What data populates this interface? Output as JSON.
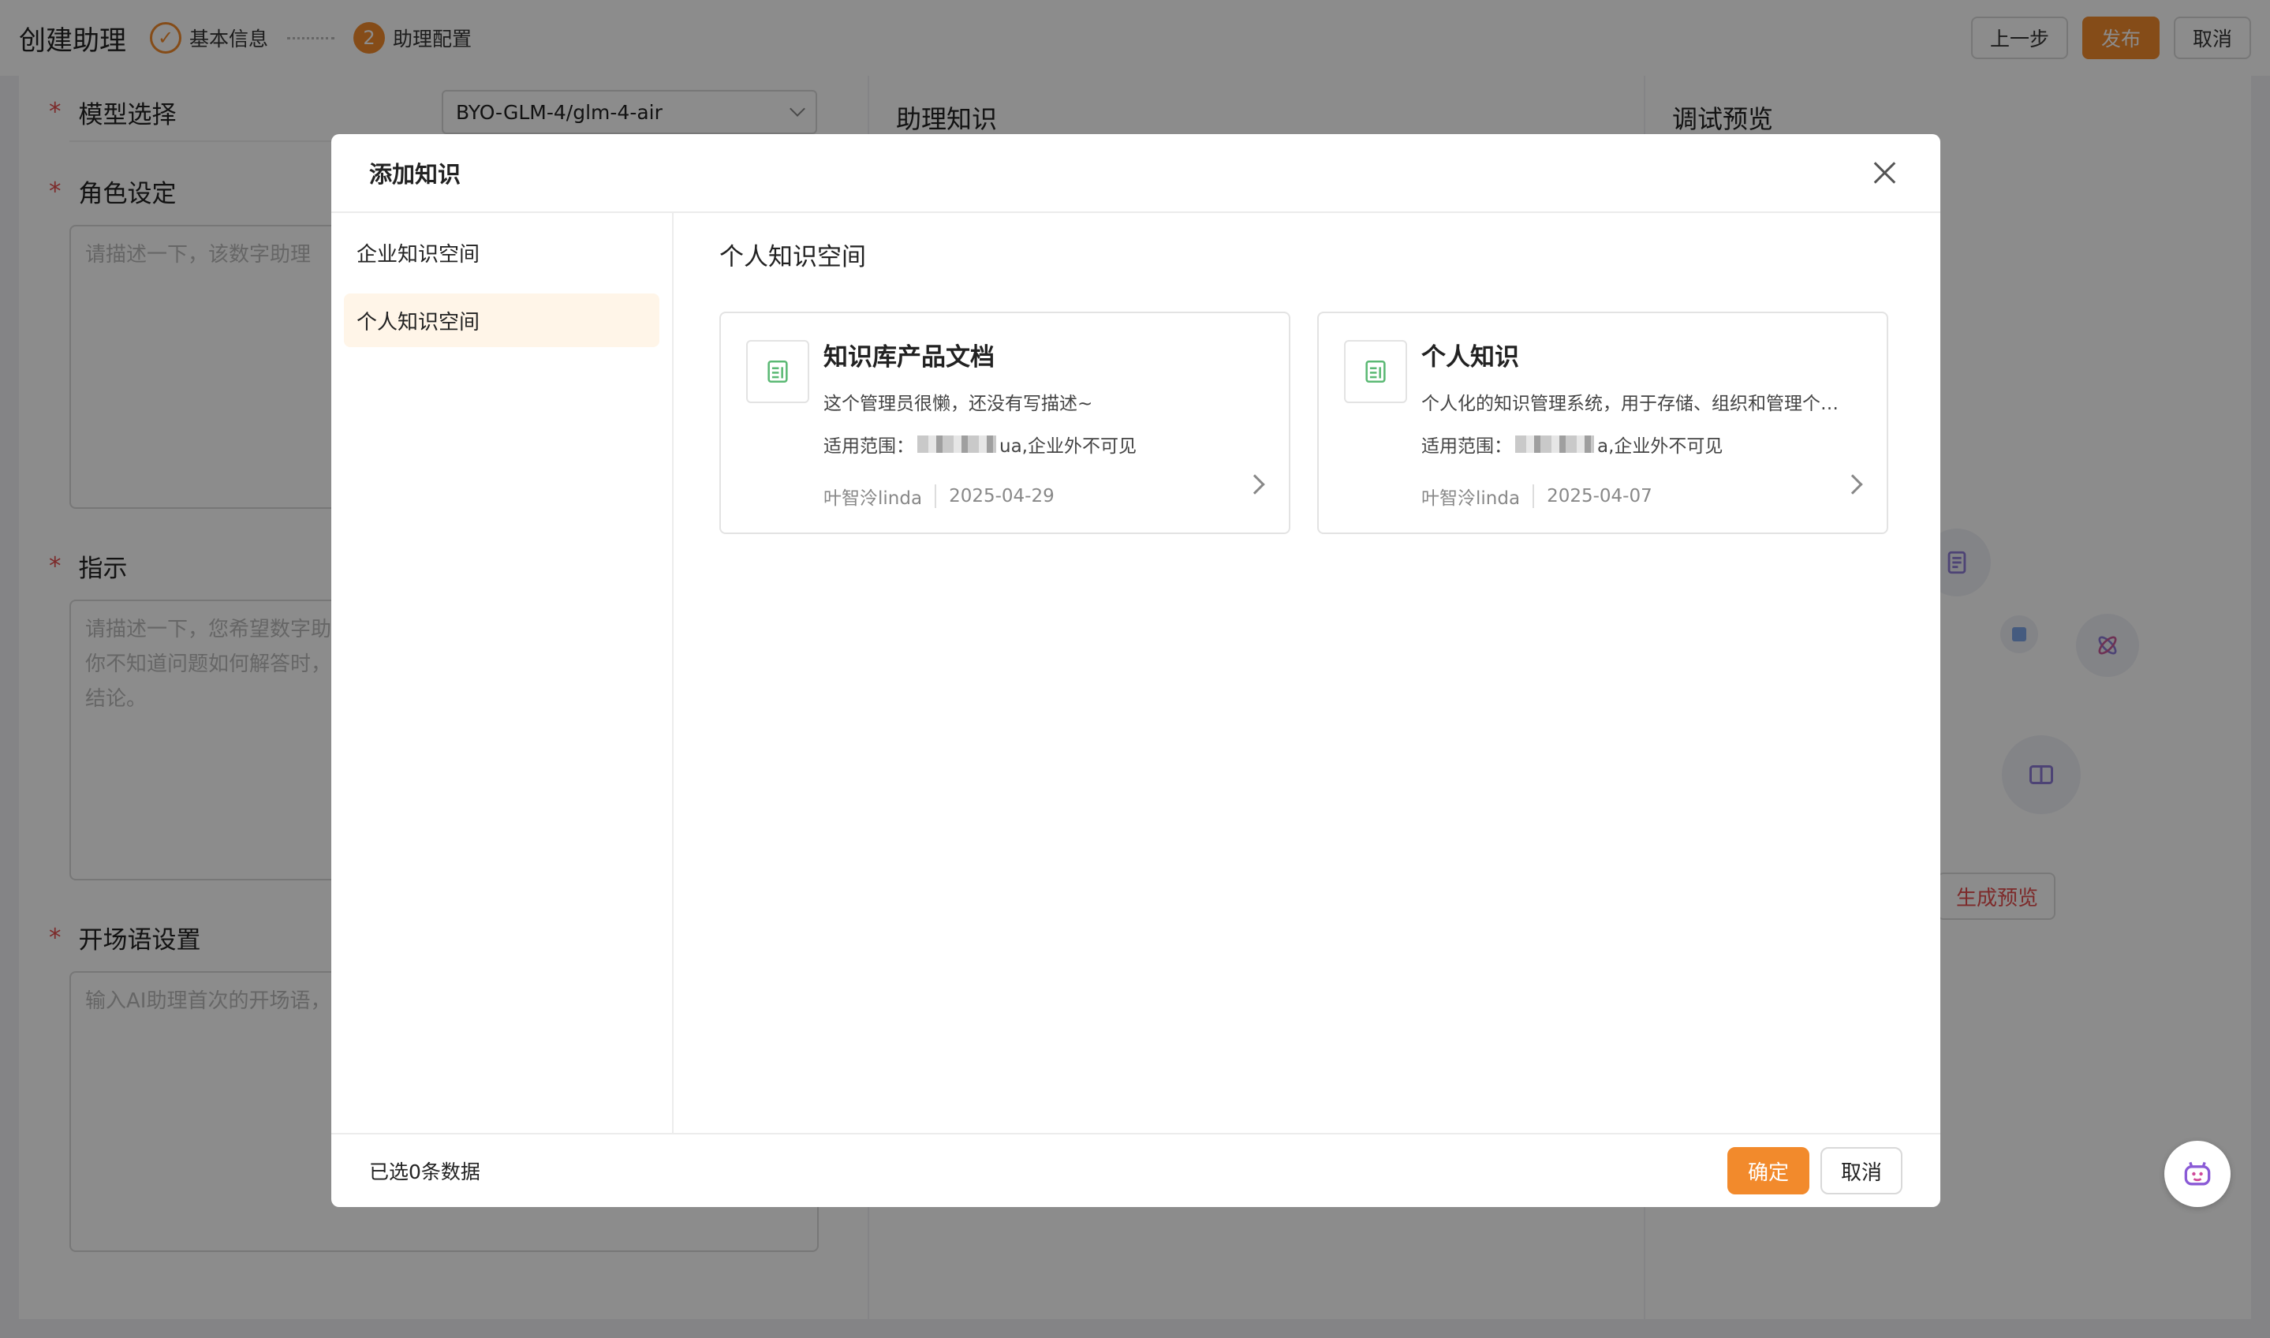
{
  "header": {
    "title": "创建助理",
    "steps": [
      {
        "label": "基本信息",
        "number": "✓"
      },
      {
        "label": "助理配置",
        "number": "2"
      }
    ],
    "actions": {
      "prev": "上一步",
      "publish": "发布",
      "cancel": "取消"
    }
  },
  "form": {
    "model": {
      "label": "模型选择",
      "value": "BYO-GLM-4/glm-4-air"
    },
    "role": {
      "label": "角色设定",
      "placeholder": "请描述一下，该数字助理"
    },
    "instruction": {
      "label": "指示",
      "placeholder": "请描述一下，您希望数字助\n你不知道问题如何解答时，\n结论。"
    },
    "opening": {
      "label": "开场语设置",
      "placeholder": "输入AI助理首次的开场语，"
    },
    "required_mark": "*"
  },
  "knowledge_panel": {
    "title": "助理知识"
  },
  "preview_panel": {
    "title": "调试预览",
    "generate_label": "生成预览"
  },
  "modal": {
    "title": "添加知识",
    "sidebar": [
      {
        "label": "企业知识空间",
        "active": false
      },
      {
        "label": "个人知识空间",
        "active": true
      }
    ],
    "content_title": "个人知识空间",
    "cards": [
      {
        "title": "知识库产品文档",
        "description": "这个管理员很懒，还没有写描述~",
        "scope_prefix": "适用范围：",
        "scope_suffix": "ua,企业外不可见",
        "author": "叶智泠linda",
        "date": "2025-04-29"
      },
      {
        "title": "个人知识",
        "description": "个人化的知识管理系统，用于存储、组织和管理个…",
        "scope_prefix": "适用范围：",
        "scope_suffix": "a,企业外不可见",
        "author": "叶智泠linda",
        "date": "2025-04-07"
      }
    ],
    "footer": {
      "selected_text": "已选0条数据",
      "confirm": "确定",
      "cancel": "取消"
    }
  },
  "colors": {
    "accent": "#f28a2c",
    "required": "#e34d4d",
    "doc_icon": "#5bb974"
  }
}
